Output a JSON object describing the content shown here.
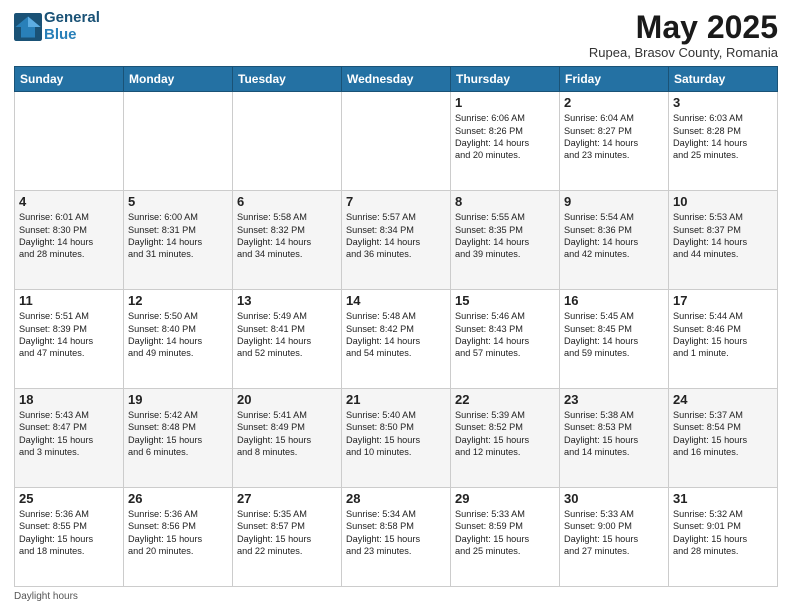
{
  "logo": {
    "line1": "General",
    "line2": "Blue"
  },
  "title": "May 2025",
  "subtitle": "Rupea, Brasov County, Romania",
  "header": {
    "days": [
      "Sunday",
      "Monday",
      "Tuesday",
      "Wednesday",
      "Thursday",
      "Friday",
      "Saturday"
    ]
  },
  "footer": {
    "note": "Daylight hours"
  },
  "weeks": [
    [
      {
        "day": "",
        "info": ""
      },
      {
        "day": "",
        "info": ""
      },
      {
        "day": "",
        "info": ""
      },
      {
        "day": "",
        "info": ""
      },
      {
        "day": "1",
        "info": "Sunrise: 6:06 AM\nSunset: 8:26 PM\nDaylight: 14 hours\nand 20 minutes."
      },
      {
        "day": "2",
        "info": "Sunrise: 6:04 AM\nSunset: 8:27 PM\nDaylight: 14 hours\nand 23 minutes."
      },
      {
        "day": "3",
        "info": "Sunrise: 6:03 AM\nSunset: 8:28 PM\nDaylight: 14 hours\nand 25 minutes."
      }
    ],
    [
      {
        "day": "4",
        "info": "Sunrise: 6:01 AM\nSunset: 8:30 PM\nDaylight: 14 hours\nand 28 minutes."
      },
      {
        "day": "5",
        "info": "Sunrise: 6:00 AM\nSunset: 8:31 PM\nDaylight: 14 hours\nand 31 minutes."
      },
      {
        "day": "6",
        "info": "Sunrise: 5:58 AM\nSunset: 8:32 PM\nDaylight: 14 hours\nand 34 minutes."
      },
      {
        "day": "7",
        "info": "Sunrise: 5:57 AM\nSunset: 8:34 PM\nDaylight: 14 hours\nand 36 minutes."
      },
      {
        "day": "8",
        "info": "Sunrise: 5:55 AM\nSunset: 8:35 PM\nDaylight: 14 hours\nand 39 minutes."
      },
      {
        "day": "9",
        "info": "Sunrise: 5:54 AM\nSunset: 8:36 PM\nDaylight: 14 hours\nand 42 minutes."
      },
      {
        "day": "10",
        "info": "Sunrise: 5:53 AM\nSunset: 8:37 PM\nDaylight: 14 hours\nand 44 minutes."
      }
    ],
    [
      {
        "day": "11",
        "info": "Sunrise: 5:51 AM\nSunset: 8:39 PM\nDaylight: 14 hours\nand 47 minutes."
      },
      {
        "day": "12",
        "info": "Sunrise: 5:50 AM\nSunset: 8:40 PM\nDaylight: 14 hours\nand 49 minutes."
      },
      {
        "day": "13",
        "info": "Sunrise: 5:49 AM\nSunset: 8:41 PM\nDaylight: 14 hours\nand 52 minutes."
      },
      {
        "day": "14",
        "info": "Sunrise: 5:48 AM\nSunset: 8:42 PM\nDaylight: 14 hours\nand 54 minutes."
      },
      {
        "day": "15",
        "info": "Sunrise: 5:46 AM\nSunset: 8:43 PM\nDaylight: 14 hours\nand 57 minutes."
      },
      {
        "day": "16",
        "info": "Sunrise: 5:45 AM\nSunset: 8:45 PM\nDaylight: 14 hours\nand 59 minutes."
      },
      {
        "day": "17",
        "info": "Sunrise: 5:44 AM\nSunset: 8:46 PM\nDaylight: 15 hours\nand 1 minute."
      }
    ],
    [
      {
        "day": "18",
        "info": "Sunrise: 5:43 AM\nSunset: 8:47 PM\nDaylight: 15 hours\nand 3 minutes."
      },
      {
        "day": "19",
        "info": "Sunrise: 5:42 AM\nSunset: 8:48 PM\nDaylight: 15 hours\nand 6 minutes."
      },
      {
        "day": "20",
        "info": "Sunrise: 5:41 AM\nSunset: 8:49 PM\nDaylight: 15 hours\nand 8 minutes."
      },
      {
        "day": "21",
        "info": "Sunrise: 5:40 AM\nSunset: 8:50 PM\nDaylight: 15 hours\nand 10 minutes."
      },
      {
        "day": "22",
        "info": "Sunrise: 5:39 AM\nSunset: 8:52 PM\nDaylight: 15 hours\nand 12 minutes."
      },
      {
        "day": "23",
        "info": "Sunrise: 5:38 AM\nSunset: 8:53 PM\nDaylight: 15 hours\nand 14 minutes."
      },
      {
        "day": "24",
        "info": "Sunrise: 5:37 AM\nSunset: 8:54 PM\nDaylight: 15 hours\nand 16 minutes."
      }
    ],
    [
      {
        "day": "25",
        "info": "Sunrise: 5:36 AM\nSunset: 8:55 PM\nDaylight: 15 hours\nand 18 minutes."
      },
      {
        "day": "26",
        "info": "Sunrise: 5:36 AM\nSunset: 8:56 PM\nDaylight: 15 hours\nand 20 minutes."
      },
      {
        "day": "27",
        "info": "Sunrise: 5:35 AM\nSunset: 8:57 PM\nDaylight: 15 hours\nand 22 minutes."
      },
      {
        "day": "28",
        "info": "Sunrise: 5:34 AM\nSunset: 8:58 PM\nDaylight: 15 hours\nand 23 minutes."
      },
      {
        "day": "29",
        "info": "Sunrise: 5:33 AM\nSunset: 8:59 PM\nDaylight: 15 hours\nand 25 minutes."
      },
      {
        "day": "30",
        "info": "Sunrise: 5:33 AM\nSunset: 9:00 PM\nDaylight: 15 hours\nand 27 minutes."
      },
      {
        "day": "31",
        "info": "Sunrise: 5:32 AM\nSunset: 9:01 PM\nDaylight: 15 hours\nand 28 minutes."
      }
    ]
  ]
}
